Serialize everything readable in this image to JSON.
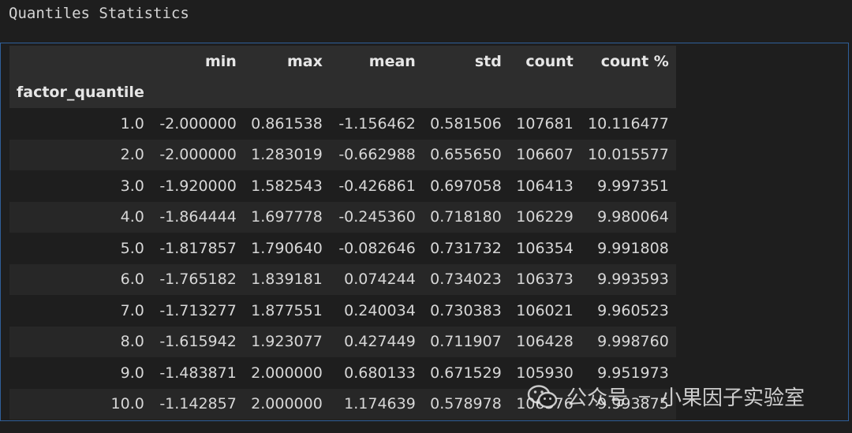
{
  "title": "Quantiles Statistics",
  "table": {
    "index_name": "factor_quantile",
    "columns": [
      "min",
      "max",
      "mean",
      "std",
      "count",
      "count %"
    ],
    "rows": [
      {
        "index": "1.0",
        "cells": [
          "-2.000000",
          "0.861538",
          "-1.156462",
          "0.581506",
          "107681",
          "10.116477"
        ]
      },
      {
        "index": "2.0",
        "cells": [
          "-2.000000",
          "1.283019",
          "-0.662988",
          "0.655650",
          "106607",
          "10.015577"
        ]
      },
      {
        "index": "3.0",
        "cells": [
          "-1.920000",
          "1.582543",
          "-0.426861",
          "0.697058",
          "106413",
          "9.997351"
        ]
      },
      {
        "index": "4.0",
        "cells": [
          "-1.864444",
          "1.697778",
          "-0.245360",
          "0.718180",
          "106229",
          "9.980064"
        ]
      },
      {
        "index": "5.0",
        "cells": [
          "-1.817857",
          "1.790640",
          "-0.082646",
          "0.731732",
          "106354",
          "9.991808"
        ]
      },
      {
        "index": "6.0",
        "cells": [
          "-1.765182",
          "1.839181",
          "0.074244",
          "0.734023",
          "106373",
          "9.993593"
        ]
      },
      {
        "index": "7.0",
        "cells": [
          "-1.713277",
          "1.877551",
          "0.240034",
          "0.730383",
          "106021",
          "9.960523"
        ]
      },
      {
        "index": "8.0",
        "cells": [
          "-1.615942",
          "1.923077",
          "0.427449",
          "0.711907",
          "106428",
          "9.998760"
        ]
      },
      {
        "index": "9.0",
        "cells": [
          "-1.483871",
          "2.000000",
          "0.680133",
          "0.671529",
          "105930",
          "9.951973"
        ]
      },
      {
        "index": "10.0",
        "cells": [
          "-1.142857",
          "2.000000",
          "1.174639",
          "0.578978",
          "106376",
          "9.993875"
        ]
      }
    ]
  },
  "watermark": {
    "prefix": "公众号",
    "name": "小果因子实验室",
    "icon": "wechat-icon"
  }
}
